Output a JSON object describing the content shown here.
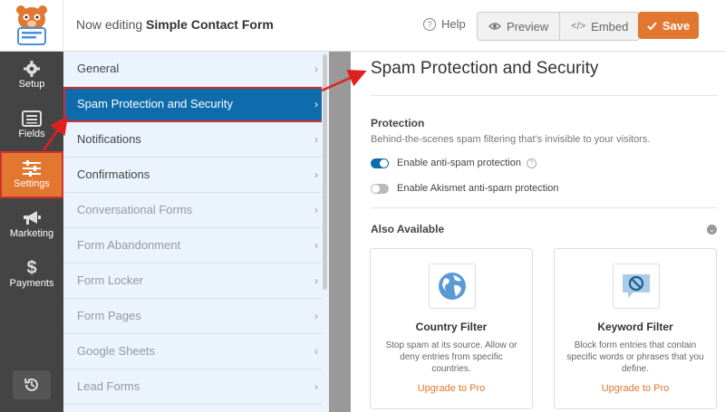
{
  "header": {
    "title_prefix": "Now editing",
    "form_name": "Simple Contact Form",
    "help_label": "Help",
    "preview_label": "Preview",
    "embed_label": "Embed",
    "save_label": "Save"
  },
  "leftnav": {
    "items": [
      {
        "label": "Setup",
        "icon": "gear-icon"
      },
      {
        "label": "Fields",
        "icon": "list-icon"
      },
      {
        "label": "Settings",
        "icon": "sliders-icon"
      },
      {
        "label": "Marketing",
        "icon": "megaphone-icon"
      },
      {
        "label": "Payments",
        "icon": "dollar-icon"
      }
    ],
    "active": "Settings"
  },
  "submenu": {
    "items": [
      {
        "label": "General",
        "state": "normal"
      },
      {
        "label": "Spam Protection and Security",
        "state": "active"
      },
      {
        "label": "Notifications",
        "state": "normal"
      },
      {
        "label": "Confirmations",
        "state": "normal"
      },
      {
        "label": "Conversational Forms",
        "state": "disabled"
      },
      {
        "label": "Form Abandonment",
        "state": "disabled"
      },
      {
        "label": "Form Locker",
        "state": "disabled"
      },
      {
        "label": "Form Pages",
        "state": "disabled"
      },
      {
        "label": "Google Sheets",
        "state": "disabled"
      },
      {
        "label": "Lead Forms",
        "state": "disabled"
      }
    ]
  },
  "panel": {
    "title": "Spam Protection and Security",
    "protection": {
      "title": "Protection",
      "description": "Behind-the-scenes spam filtering that's invisible to your visitors.",
      "toggles": [
        {
          "label": "Enable anti-spam protection",
          "on": true
        },
        {
          "label": "Enable Akismet anti-spam protection",
          "on": false
        }
      ]
    },
    "also_available": {
      "title": "Also Available",
      "cards": [
        {
          "title": "Country Filter",
          "description": "Stop spam at its source. Allow or deny entries from specific countries.",
          "link": "Upgrade to Pro",
          "icon": "globe-icon"
        },
        {
          "title": "Keyword Filter",
          "description": "Block form entries that contain specific words or phrases that you define.",
          "link": "Upgrade to Pro",
          "icon": "block-comment-icon"
        }
      ]
    }
  },
  "colors": {
    "accent_orange": "#e27730",
    "active_blue": "#0e6cad",
    "sidebar_dark": "#444444",
    "annotation_red": "#d32f2f"
  }
}
